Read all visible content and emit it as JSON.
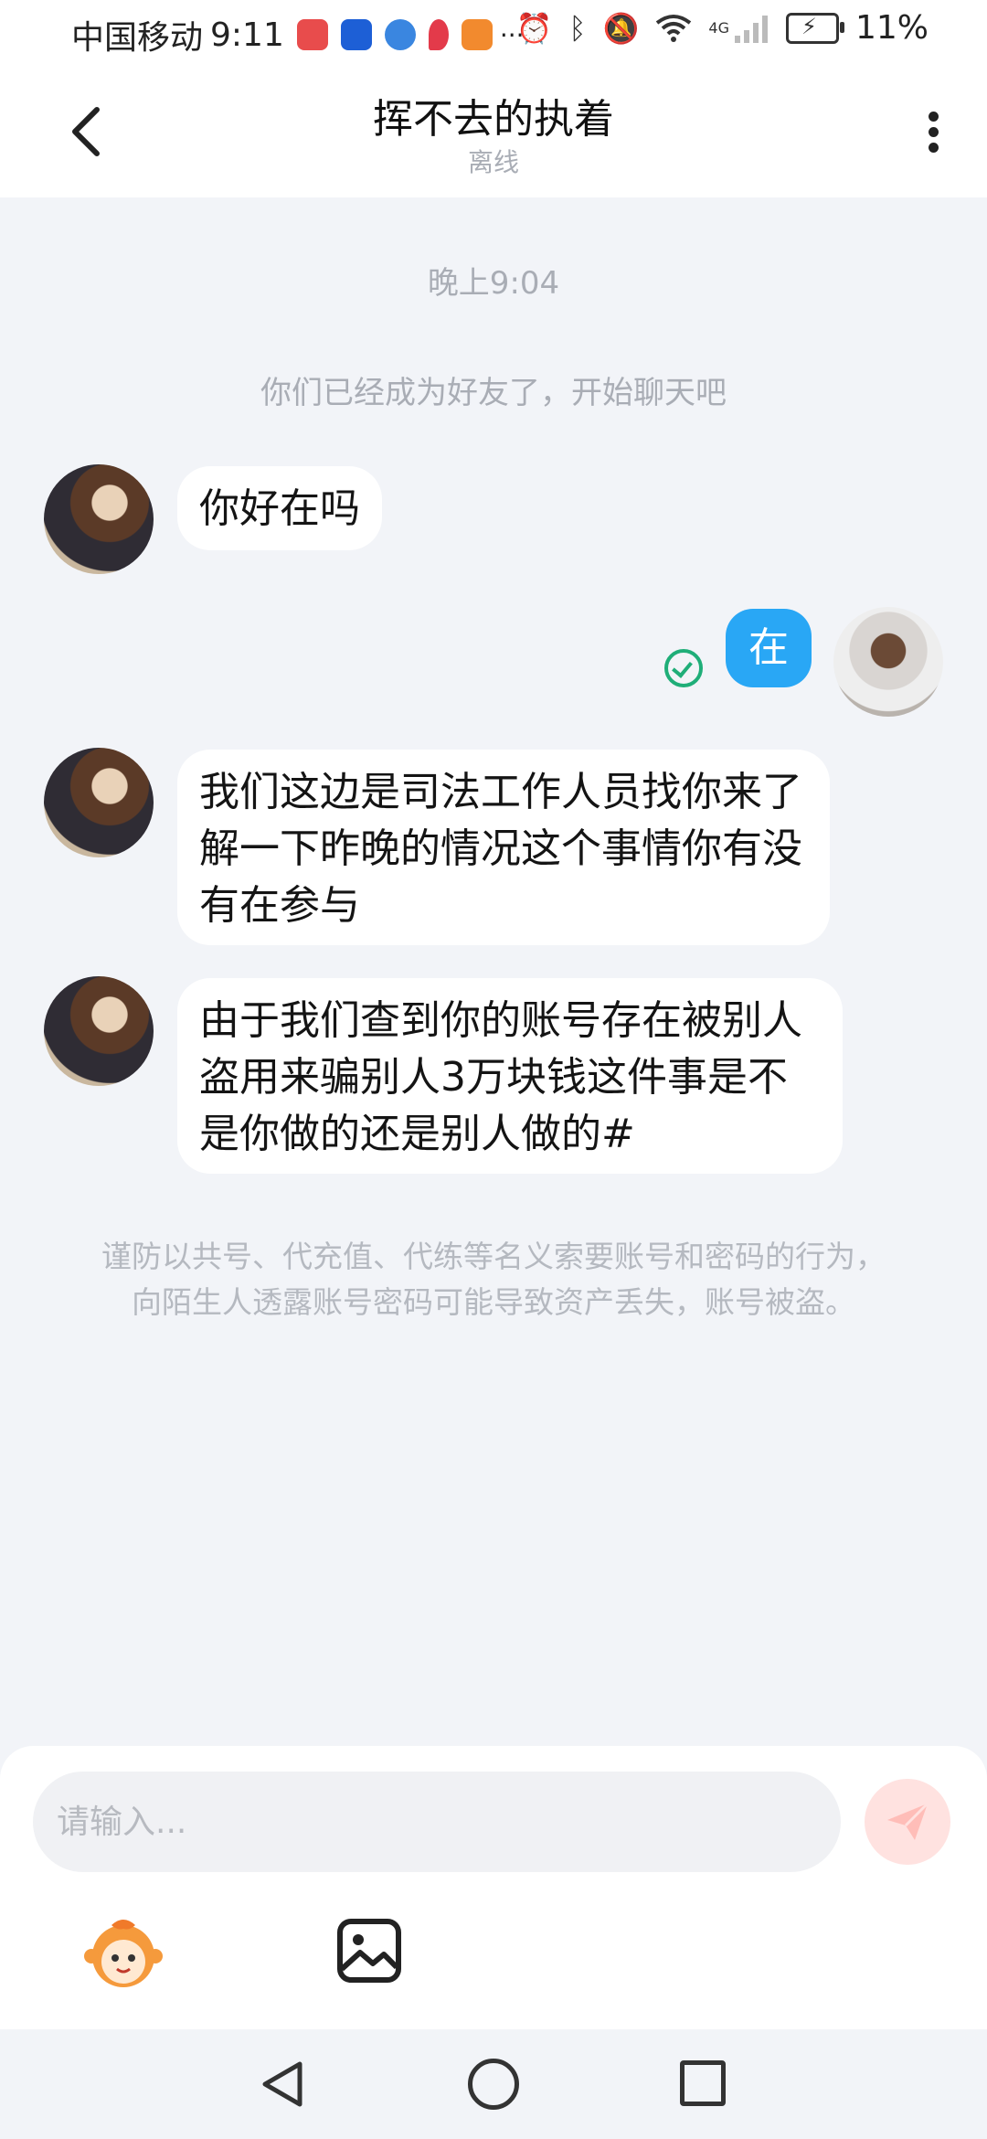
{
  "status_bar": {
    "carrier": "中国移动",
    "time": "9:11",
    "network": "4G",
    "battery": "11%",
    "app_icons": [
      "huawei-mall-icon",
      "lightbulb-app-icon",
      "globe-app-icon",
      "red-leaf-app-icon",
      "video-app-icon"
    ],
    "more": "···"
  },
  "header": {
    "title": "挥不去的执着",
    "status": "离线"
  },
  "chat": {
    "timestamp": "晚上9:04",
    "system_notice": "你们已经成为好友了，开始聊天吧",
    "messages": [
      {
        "sender": "other",
        "text": "你好在吗"
      },
      {
        "sender": "me",
        "text": "在",
        "read": true
      },
      {
        "sender": "other",
        "text": "我们这边是司法工作人员找你来了解一下昨晚的情况这个事情你有没有在参与"
      },
      {
        "sender": "other",
        "text": "由于我们查到你的账号存在被别人盗用来骗别人3万块钱这件事是不是你做的还是别人做的#"
      }
    ],
    "warning": "谨防以共号、代充值、代练等名义索要账号和密码的行为，向陌生人透露账号密码可能导致资产丢失，账号被盗。"
  },
  "composer": {
    "placeholder": "请输入..."
  },
  "colors": {
    "accent_blue": "#29A7F5",
    "read_green": "#1fae78",
    "background": "#F2F4F8"
  }
}
